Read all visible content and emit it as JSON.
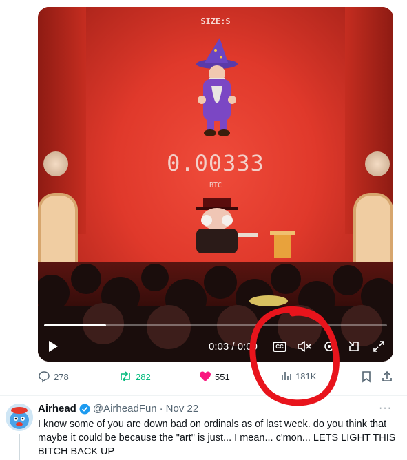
{
  "video": {
    "size_label": "SIZE:S",
    "price": "0.00333",
    "price_unit": "BTC",
    "progress_fraction": 0.18,
    "time_display": "0:03 / 0:00",
    "controls": {
      "play_icon": "play-icon",
      "captions_label": "CC",
      "mute_icon": "speaker-muted-icon",
      "settings_icon": "settings-icon",
      "dock_icon": "dock-icon",
      "fullscreen_icon": "expand-icon"
    }
  },
  "actions": {
    "replies": "278",
    "reposts": "282",
    "likes": "551",
    "views": "181K"
  },
  "colors": {
    "repost_green": "#00ba7c",
    "like_pink": "#f91880",
    "verified_blue": "#1d9bf0",
    "annotation_red": "#e8141c",
    "muted_text": "#536471"
  },
  "next_tweet": {
    "name": "Airhead",
    "handle": "@AirheadFun",
    "separator": "·",
    "date": "Nov 22",
    "more": "···",
    "text": "I know some of you are down bad on ordinals as of last week. do you think that maybe it could be because the \"art\" is just... I mean... c'mon... LETS LIGHT THIS BITCH BACK UP"
  }
}
